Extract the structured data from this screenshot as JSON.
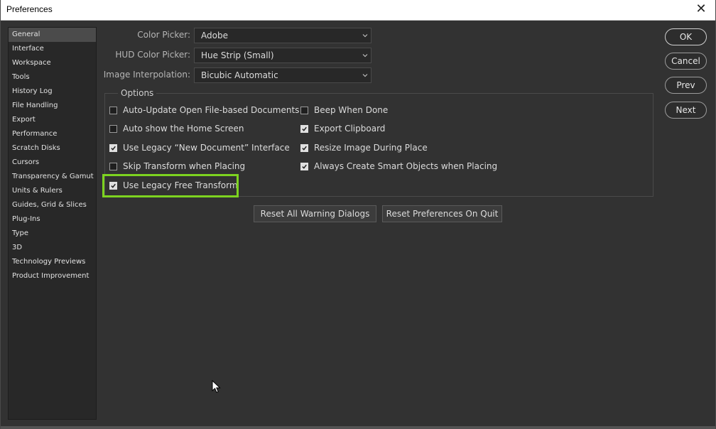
{
  "window": {
    "title": "Preferences",
    "close_glyph": "✕"
  },
  "sidebar": {
    "items": [
      {
        "label": "General"
      },
      {
        "label": "Interface"
      },
      {
        "label": "Workspace"
      },
      {
        "label": "Tools"
      },
      {
        "label": "History Log"
      },
      {
        "label": "File Handling"
      },
      {
        "label": "Export"
      },
      {
        "label": "Performance"
      },
      {
        "label": "Scratch Disks"
      },
      {
        "label": "Cursors"
      },
      {
        "label": "Transparency & Gamut"
      },
      {
        "label": "Units & Rulers"
      },
      {
        "label": "Guides, Grid & Slices"
      },
      {
        "label": "Plug-Ins"
      },
      {
        "label": "Type"
      },
      {
        "label": "3D"
      },
      {
        "label": "Technology Previews"
      },
      {
        "label": "Product Improvement"
      }
    ],
    "selected_index": 0
  },
  "fields": {
    "color_picker": {
      "label": "Color Picker:",
      "value": "Adobe"
    },
    "hud_color_picker": {
      "label": "HUD Color Picker:",
      "value": "Hue Strip (Small)"
    },
    "image_interpolation": {
      "label": "Image Interpolation:",
      "value": "Bicubic Automatic"
    }
  },
  "options": {
    "title": "Options",
    "left": [
      {
        "label": "Auto-Update Open File-based Documents",
        "checked": false
      },
      {
        "label": "Auto show the Home Screen",
        "checked": false
      },
      {
        "label": "Use Legacy “New Document” Interface",
        "checked": true
      },
      {
        "label": "Skip Transform when Placing",
        "checked": false
      },
      {
        "label": "Use Legacy Free Transform",
        "checked": true
      }
    ],
    "right": [
      {
        "label": "Beep When Done",
        "checked": false
      },
      {
        "label": "Export Clipboard",
        "checked": true
      },
      {
        "label": "Resize Image During Place",
        "checked": true
      },
      {
        "label": "Always Create Smart Objects when Placing",
        "checked": true
      }
    ]
  },
  "buttons": {
    "reset_warnings": "Reset All Warning Dialogs",
    "reset_prefs": "Reset Preferences On Quit",
    "ok": "OK",
    "cancel": "Cancel",
    "prev": "Prev",
    "next": "Next"
  },
  "colors": {
    "highlight": "#7dd320",
    "background": "#323232",
    "sidebar_selected": "#4b4b4b"
  }
}
